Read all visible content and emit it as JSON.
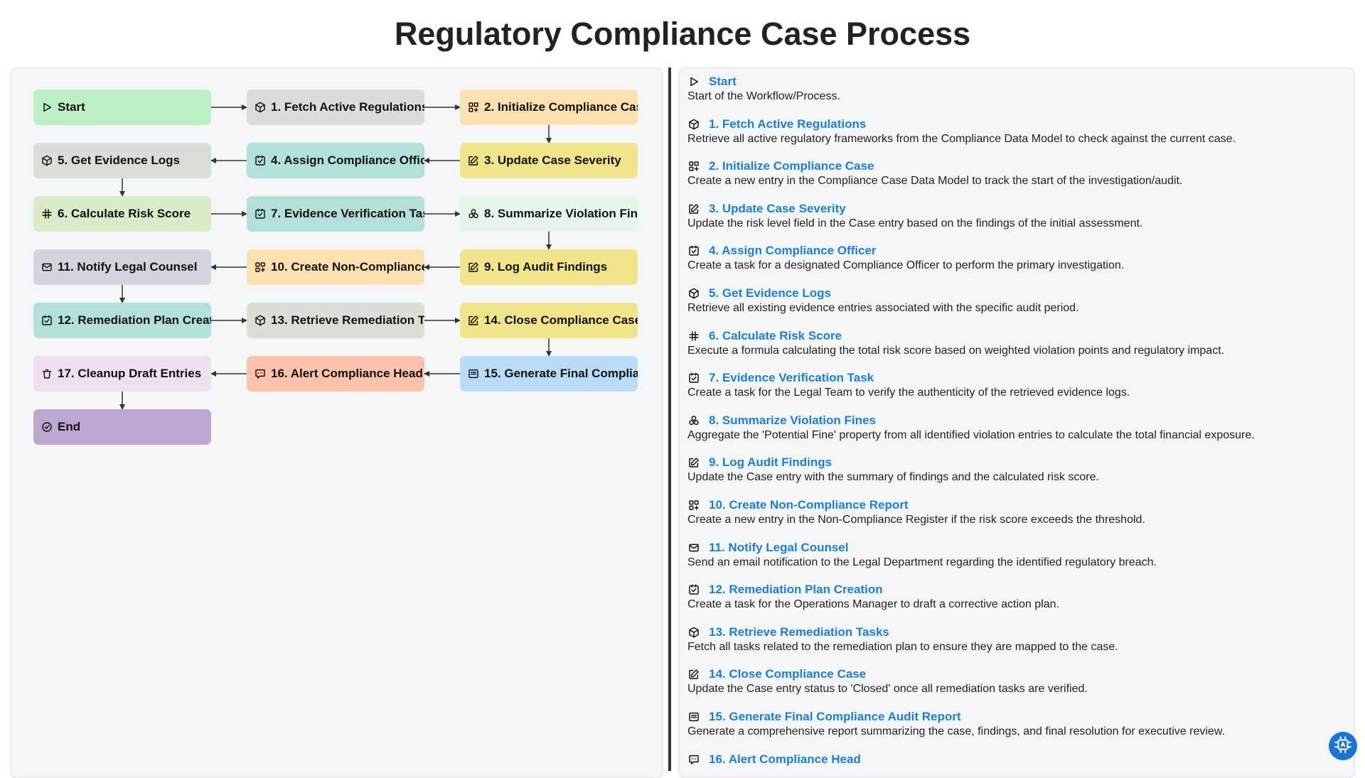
{
  "title": "Regulatory Compliance Case Process",
  "colors": {
    "green": "#bdf0c4",
    "sage": "#d8dfd6",
    "peach": "#fde0b0",
    "yellow": "#f0e58a",
    "teal": "#b4e0da",
    "lime": "#dbebc8",
    "mint": "#e6f4e9",
    "slate": "#d0d6dc",
    "salmon": "#fcc2ac",
    "blue": "#b9dcf6",
    "lavender": "#efe0f0",
    "purple": "#bba7d0",
    "link": "#1a7fd9"
  },
  "nodes": [
    {
      "id": "start",
      "label": "Start",
      "icon": "play-icon",
      "color": "green"
    },
    {
      "id": "s1",
      "label": "1. Fetch Active Regulations",
      "icon": "cube-icon",
      "color": "sage"
    },
    {
      "id": "s2",
      "label": "2. Initialize Compliance Case",
      "icon": "grid-plus-icon",
      "color": "peach"
    },
    {
      "id": "s3",
      "label": "3. Update Case Severity",
      "icon": "edit-icon",
      "color": "yellow"
    },
    {
      "id": "s4",
      "label": "4. Assign Compliance Officer",
      "icon": "task-check-icon",
      "color": "teal"
    },
    {
      "id": "s5",
      "label": "5. Get Evidence Logs",
      "icon": "cube-icon",
      "color": "sage"
    },
    {
      "id": "s6",
      "label": "6. Calculate Risk Score",
      "icon": "hash-icon",
      "color": "lime"
    },
    {
      "id": "s7",
      "label": "7. Evidence Verification Task",
      "icon": "task-check-icon",
      "color": "teal"
    },
    {
      "id": "s8",
      "label": "8. Summarize Violation Fines",
      "icon": "aggregate-icon",
      "color": "mint"
    },
    {
      "id": "s9",
      "label": "9. Log Audit Findings",
      "icon": "edit-icon",
      "color": "yellow"
    },
    {
      "id": "s10",
      "label": "10. Create Non-Compliance Report",
      "icon": "grid-plus-icon",
      "color": "peach"
    },
    {
      "id": "s11",
      "label": "11. Notify Legal Counsel",
      "icon": "mail-icon",
      "color": "slate"
    },
    {
      "id": "s12",
      "label": "12. Remediation Plan Creation",
      "icon": "task-check-icon",
      "color": "teal"
    },
    {
      "id": "s13",
      "label": "13. Retrieve Remediation Tasks",
      "icon": "cube-icon",
      "color": "sage"
    },
    {
      "id": "s14",
      "label": "14. Close Compliance Case",
      "icon": "edit-icon",
      "color": "yellow"
    },
    {
      "id": "s15",
      "label": "15. Generate Final Compliance Audit Report",
      "icon": "report-icon",
      "color": "blue"
    },
    {
      "id": "s16",
      "label": "16. Alert Compliance Head",
      "icon": "chat-icon",
      "color": "salmon"
    },
    {
      "id": "s17",
      "label": "17. Cleanup Draft Entries",
      "icon": "trash-icon",
      "color": "lavender"
    },
    {
      "id": "end",
      "label": "End",
      "icon": "check-circle-icon",
      "color": "purple"
    }
  ],
  "steps": [
    {
      "name": "Start",
      "icon": "play-icon",
      "desc": "Start of the Workflow/Process."
    },
    {
      "name": "1. Fetch Active Regulations",
      "icon": "cube-icon",
      "desc": "Retrieve all active regulatory frameworks from the Compliance Data Model to check against the current case."
    },
    {
      "name": "2. Initialize Compliance Case",
      "icon": "grid-plus-icon",
      "desc": "Create a new entry in the Compliance Case Data Model to track the start of the investigation/audit."
    },
    {
      "name": "3. Update Case Severity",
      "icon": "edit-icon",
      "desc": "Update the risk level field in the Case entry based on the findings of the initial assessment."
    },
    {
      "name": "4. Assign Compliance Officer",
      "icon": "task-check-icon",
      "desc": "Create a task for a designated Compliance Officer to perform the primary investigation."
    },
    {
      "name": "5. Get Evidence Logs",
      "icon": "cube-icon",
      "desc": "Retrieve all existing evidence entries associated with the specific audit period."
    },
    {
      "name": "6. Calculate Risk Score",
      "icon": "hash-icon",
      "desc": "Execute a formula calculating the total risk score based on weighted violation points and regulatory impact."
    },
    {
      "name": "7. Evidence Verification Task",
      "icon": "task-check-icon",
      "desc": "Create a task for the Legal Team to verify the authenticity of the retrieved evidence logs."
    },
    {
      "name": "8. Summarize Violation Fines",
      "icon": "aggregate-icon",
      "desc": "Aggregate the 'Potential Fine' property from all identified violation entries to calculate the total financial exposure."
    },
    {
      "name": "9. Log Audit Findings",
      "icon": "edit-icon",
      "desc": "Update the Case entry with the summary of findings and the calculated risk score."
    },
    {
      "name": "10. Create Non-Compliance Report",
      "icon": "grid-plus-icon",
      "desc": "Create a new entry in the Non-Compliance Register if the risk score exceeds the threshold."
    },
    {
      "name": "11. Notify Legal Counsel",
      "icon": "mail-icon",
      "desc": "Send an email notification to the Legal Department regarding the identified regulatory breach."
    },
    {
      "name": "12. Remediation Plan Creation",
      "icon": "task-check-icon",
      "desc": "Create a task for the Operations Manager to draft a corrective action plan."
    },
    {
      "name": "13. Retrieve Remediation Tasks",
      "icon": "cube-icon",
      "desc": "Fetch all tasks related to the remediation plan to ensure they are mapped to the case."
    },
    {
      "name": "14. Close Compliance Case",
      "icon": "edit-icon",
      "desc": "Update the Case entry status to 'Closed' once all remediation tasks are verified."
    },
    {
      "name": "15. Generate Final Compliance Audit Report",
      "icon": "report-icon",
      "desc": "Generate a comprehensive report summarizing the case, findings, and final resolution for executive review."
    },
    {
      "name": "16. Alert Compliance Head",
      "icon": "chat-icon",
      "desc": ""
    }
  ],
  "help_button": {
    "icon": "assistant-icon"
  }
}
